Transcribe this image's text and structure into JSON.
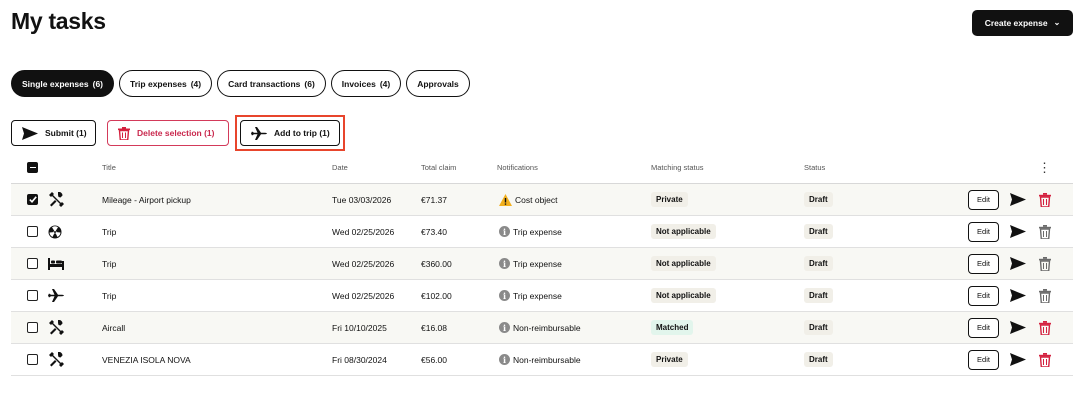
{
  "page": {
    "title": "My tasks"
  },
  "header": {
    "create_label": "Create expense"
  },
  "tabs": [
    {
      "label": "Single expenses",
      "count": "(6)",
      "active": true
    },
    {
      "label": "Trip expenses",
      "count": "(4)"
    },
    {
      "label": "Card transactions",
      "count": "(6)"
    },
    {
      "label": "Invoices",
      "count": "(4)"
    },
    {
      "label": "Approvals",
      "count": ""
    }
  ],
  "actions": {
    "submit_label": "Submit (1)",
    "delete_label": "Delete selection (1)",
    "add_trip_label": "Add to trip (1)"
  },
  "table": {
    "headers": {
      "title": "Title",
      "date": "Date",
      "total": "Total claim",
      "notifications": "Notifications",
      "matching": "Matching status",
      "status": "Status"
    },
    "edit_label": "Edit",
    "rows": [
      {
        "checked": true,
        "icon": "tools-icon",
        "title": "Mileage - Airport pickup",
        "date": "Tue 03/03/2026",
        "total": "€71.37",
        "notif_icon": "warning-icon",
        "notification": "Cost object",
        "matching": "Private",
        "status": "Draft",
        "trash_active": true
      },
      {
        "checked": false,
        "icon": "radiation-icon",
        "title": "Trip",
        "date": "Wed 02/25/2026",
        "total": "€73.40",
        "notif_icon": "info-icon",
        "notification": "Trip expense",
        "matching": "Not applicable",
        "status": "Draft",
        "trash_active": false
      },
      {
        "checked": false,
        "icon": "bed-icon",
        "title": "Trip",
        "date": "Wed 02/25/2026",
        "total": "€360.00",
        "notif_icon": "info-icon",
        "notification": "Trip expense",
        "matching": "Not applicable",
        "status": "Draft",
        "trash_active": false
      },
      {
        "checked": false,
        "icon": "airplane-icon",
        "title": "Trip",
        "date": "Wed 02/25/2026",
        "total": "€102.00",
        "notif_icon": "info-icon",
        "notification": "Trip expense",
        "matching": "Not applicable",
        "status": "Draft",
        "trash_active": false
      },
      {
        "checked": false,
        "icon": "tools-icon",
        "title": "Aircall",
        "date": "Fri 10/10/2025",
        "total": "€16.08",
        "notif_icon": "info-icon",
        "notification": "Non-reimbursable",
        "matching": "Matched",
        "status": "Draft",
        "trash_active": true
      },
      {
        "checked": false,
        "icon": "tools-icon",
        "title": "VENEZIA ISOLA NOVA",
        "date": "Fri 08/30/2024",
        "total": "€56.00",
        "notif_icon": "info-icon",
        "notification": "Non-reimbursable",
        "matching": "Private",
        "status": "Draft",
        "trash_active": true
      }
    ]
  },
  "colors": {
    "danger": "#d4213f",
    "warning": "#f2b01e",
    "muted_icon": "#6b6b6b",
    "matched_bg": "#e2f5ec"
  }
}
